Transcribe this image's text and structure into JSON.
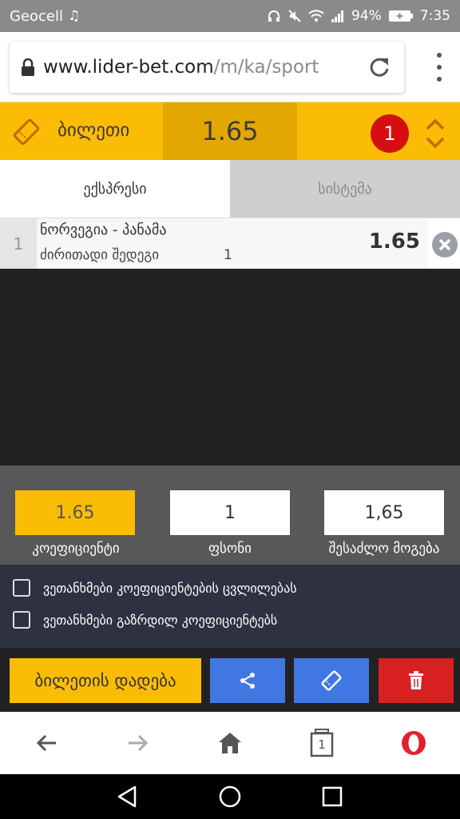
{
  "status_bar": {
    "carrier": "Geocell",
    "battery": "94%",
    "time": "7:35"
  },
  "browser": {
    "url_domain": "www.lider-bet.com",
    "url_path": "/m/ka/sport"
  },
  "ticket": {
    "title": "ბილეთი",
    "total_odds": "1.65",
    "count": "1"
  },
  "tabs": [
    {
      "label": "ექსპრესი",
      "active": true
    },
    {
      "label": "სისტემა",
      "active": false
    }
  ],
  "bets": [
    {
      "number": "1",
      "teams": "ნორვეგია - პანამა",
      "market": "ძირითადი შედეგი",
      "selection": "1",
      "odds": "1.65"
    }
  ],
  "summary": {
    "coefficient": "1.65",
    "stake": "1",
    "possible_win": "1,65",
    "coefficient_label": "კოეფიციენტი",
    "stake_label": "ფსონი",
    "possible_win_label": "შესაძლო მოგება"
  },
  "options": [
    {
      "label": "ვეთანხმები კოეფიციენტების ცვლილებას",
      "checked": false
    },
    {
      "label": "ვეთანხმები გაზრდილ კოეფიციენტებს",
      "checked": false
    }
  ],
  "actions": {
    "place_label": "ბილეთის დადება"
  },
  "browser_nav": {
    "tab_count": "1"
  },
  "colors": {
    "accent": "#fbbc05",
    "accent_dark": "#e3a702",
    "badge_red": "#d50f0f",
    "action_blue": "#4177e3",
    "delete_red": "#d7201f"
  }
}
